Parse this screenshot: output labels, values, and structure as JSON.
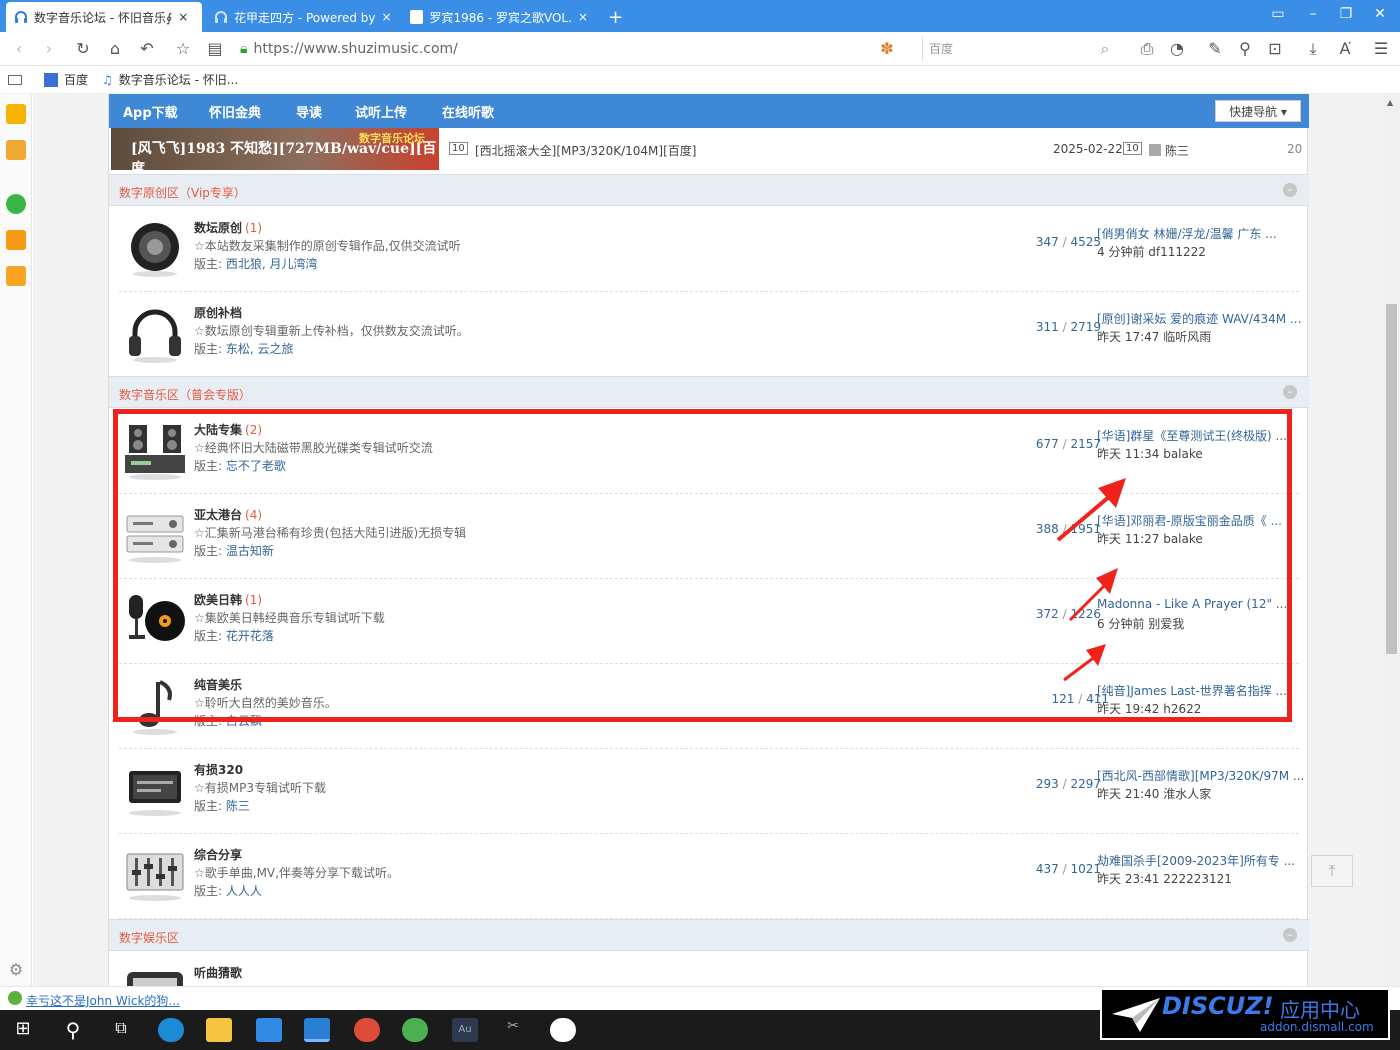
{
  "browser": {
    "tabs": [
      {
        "title": "数字音乐论坛 - 怀旧音乐∮",
        "close": "×"
      },
      {
        "title": "花甲走四方 - Powered by",
        "close": "×"
      },
      {
        "title": "罗宾1986 - 罗宾之歌VOL.",
        "close": "×"
      }
    ],
    "new_tab": "+",
    "url": "https://www.shuzimusic.com/",
    "search_placeholder": "百度",
    "bookmarks": [
      {
        "label": "百度"
      },
      {
        "label": "数字音乐论坛 - 怀旧..."
      }
    ]
  },
  "forum": {
    "topnav": [
      "App下载",
      "怀旧金典",
      "导读",
      "试听上传",
      "在线听歌"
    ],
    "quicknav": "快捷导航 ▾",
    "banner_text": "[风飞飞]1983 不知愁][727MB/wav/cue][百度",
    "banner_logo": "数字音乐论坛",
    "top_rows": [
      {
        "num": "10",
        "title": "[西北摇滚大全][MP3/320K/104M][百度]",
        "date": "2025-02-22",
        "rank": "10",
        "user": "陈三",
        "count": "20"
      }
    ],
    "categories": [
      {
        "title": "数字原创区（Vip专享）",
        "forums": [
          {
            "name": "数坛原创",
            "count": "(1)",
            "desc": "☆本站数友采集制作的原创专辑作品,仅供交流试听",
            "mod_label": "版主:",
            "mods": "西北狼, 月儿湾湾",
            "stats_a": "347",
            "stats_b": "4525",
            "last_title": "[俏男俏女 林姗/浮龙/温馨 广东 ...",
            "last_time": "4 分钟前 df111222"
          },
          {
            "name": "原创补档",
            "count": "",
            "desc": "☆数坛原创专辑重新上传补档，仅供数友交流试听。",
            "mod_label": "版主:",
            "mods": "东松, 云之旅",
            "stats_a": "311",
            "stats_b": "2719",
            "last_title": "[原创]谢采妘 爱的痕迹 WAV/434M ...",
            "last_time": "昨天 17:47 临听风雨"
          }
        ]
      },
      {
        "title": "数字音乐区（普会专版）",
        "forums": [
          {
            "name": "大陆专集",
            "count": "(2)",
            "desc": "☆经典怀旧大陆磁带黑胶光碟类专辑试听交流",
            "mod_label": "版主:",
            "mods": "忘不了老歌",
            "stats_a": "677",
            "stats_b": "2157",
            "last_title": "[华语]群星《至尊测试王(终极版) ...",
            "last_time": "昨天 11:34 balake"
          },
          {
            "name": "亚太港台",
            "count": "(4)",
            "desc": "☆汇集新马港台稀有珍贵(包括大陆引进版)无损专辑",
            "mod_label": "版主:",
            "mods": "温古知新",
            "stats_a": "388",
            "stats_b": "1951",
            "last_title": "[华语]邓丽君-原版宝丽金品质《 ...",
            "last_time": "昨天 11:27 balake"
          },
          {
            "name": "欧美日韩",
            "count": "(1)",
            "desc": "☆集欧美日韩经典音乐专辑试听下载",
            "mod_label": "版主:",
            "mods": "花开花落",
            "stats_a": "372",
            "stats_b": "1226",
            "last_title": "Madonna - Like A Prayer (12\" ...",
            "last_time": "6 分钟前 别爱我"
          },
          {
            "name": "纯音美乐",
            "count": "",
            "desc": "☆聆听大自然的美妙音乐。",
            "mod_label": "版主:",
            "mods": "白云飘",
            "stats_a": "121",
            "stats_b": "411",
            "last_title": "[纯音]James Last-世界著名指挥 ...",
            "last_time": "昨天 19:42 h2622"
          },
          {
            "name": "有损320",
            "count": "",
            "desc": "☆有损MP3专辑试听下载",
            "mod_label": "版主:",
            "mods": "陈三",
            "stats_a": "293",
            "stats_b": "2297",
            "last_title": "[西北风-西部情歌][MP3/320K/97M ...",
            "last_time": "昨天 21:40 淮水人家"
          },
          {
            "name": "综合分享",
            "count": "",
            "desc": "☆歌手单曲,MV,伴奏等分享下载试听。",
            "mod_label": "版主:",
            "mods": "人人人",
            "stats_a": "437",
            "stats_b": "1021",
            "last_title": "劫难国杀手[2009-2023年]所有专 ...",
            "last_time": "昨天 23:41 222223121"
          }
        ]
      },
      {
        "title": "数字娱乐区",
        "forums": [
          {
            "name": "听曲猜歌",
            "count": "",
            "desc": "",
            "mod_label": "",
            "mods": "",
            "stats_a": "",
            "stats_b": "",
            "last_title": "",
            "last_time": ""
          }
        ]
      }
    ],
    "stats_sep": " / "
  },
  "status": {
    "news_link": "幸亏这不是John Wick的狗..."
  },
  "watermark": {
    "brand": "DISCUZ!",
    "title": "应用中心",
    "url": "addon.dismall.com"
  },
  "colors": {
    "tabbar": "#3a8ee6",
    "topnav": "#3e88d6",
    "highlight": "#f0231c",
    "category_title": "#e35b40",
    "link": "#336699"
  }
}
